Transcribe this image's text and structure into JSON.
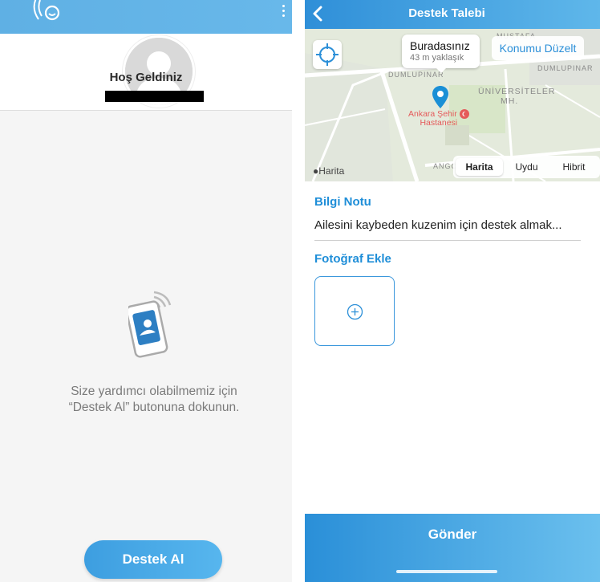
{
  "left_screen": {
    "welcome_title": "Hoş Geldiniz",
    "hint_text": "Size yardımcı olabilmemiz için\n“Destek Al” butonuna dokunun.",
    "support_button": "Destek Al",
    "icons": [
      "app-logo-icon",
      "more-options-icon",
      "avatar-placeholder",
      "phone-signal-icon"
    ]
  },
  "right_screen": {
    "nav_title": "Destek Talebi",
    "map": {
      "callout_title": "Buradasınız",
      "callout_subtitle": "43 m yaklaşık",
      "edit_location_button": "Konumu Düzelt",
      "street_label_1": "DUMLUPINAR",
      "street_label_2": "DUMLUPINAR",
      "district_label_1": "ÜNİVERSİTELER",
      "district_label_2": "MH.",
      "mustafa_label": "MUSTAFA",
      "hospital_line_1": "Ankara Şehir",
      "hospital_line_2": "Hastanesi",
      "ango_label": "ANGO",
      "provider_label": "Harita",
      "map_types": [
        {
          "label": "Harita",
          "active": true
        },
        {
          "label": "Uydu",
          "active": false
        },
        {
          "label": "Hibrit",
          "active": false
        }
      ]
    },
    "info_note_title": "Bilgi Notu",
    "info_note_text": "Ailesini kaybeden kuzenim için destek almak...",
    "photo_title": "Fotoğraf Ekle",
    "send_button": "Gönder"
  },
  "colors": {
    "accent_blue": "#1f8ed8",
    "header_blue": "#5fb0e4",
    "hospital_red": "#e55a5a",
    "pin_blue": "#1a8fd6"
  }
}
